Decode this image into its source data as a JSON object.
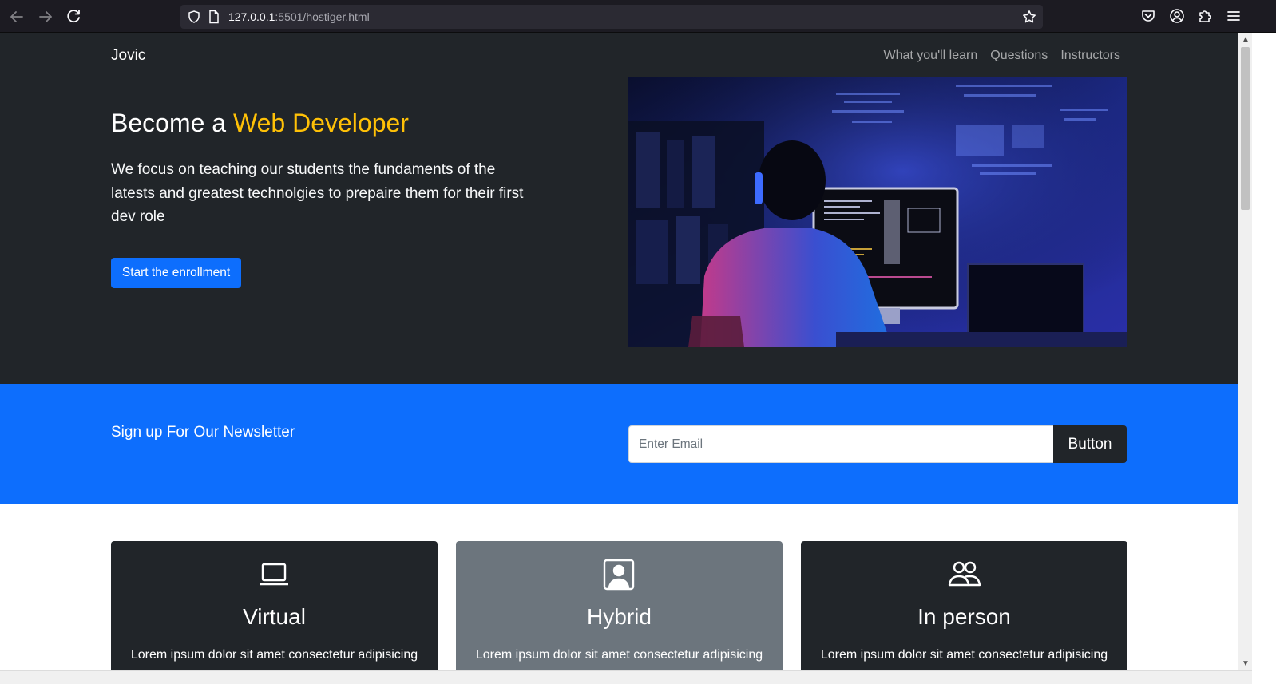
{
  "browser": {
    "url_host": "127.0.0.1",
    "url_rest": ":5501/hostiger.html",
    "icons": [
      "back-icon",
      "forward-icon",
      "reload-icon",
      "shield-icon",
      "page-icon",
      "bookmark-star-icon",
      "pocket-icon",
      "account-icon",
      "extensions-icon",
      "menu-icon"
    ]
  },
  "navbar": {
    "brand": "Jovic",
    "links": [
      "What you'll learn",
      "Questions",
      "Instructors"
    ]
  },
  "hero": {
    "title_prefix": "Become a ",
    "title_accent": "Web Developer",
    "description": "We focus on teaching our students the fundaments of the latests and greatest technolgies to prepaire them for their first dev role",
    "cta_label": "Start the enrollment",
    "accent_color": "#ffc107"
  },
  "newsletter": {
    "title": "Sign up For Our Newsletter",
    "email_placeholder": "Enter Email",
    "button_label": "Button",
    "bg_color": "#0d6efd"
  },
  "cards": [
    {
      "icon": "laptop-icon",
      "title": "Virtual",
      "text": "Lorem ipsum dolor sit amet consectetur adipisicing"
    },
    {
      "icon": "person-badge-icon",
      "title": "Hybrid",
      "text": "Lorem ipsum dolor sit amet consectetur adipisicing"
    },
    {
      "icon": "people-icon",
      "title": "In person",
      "text": "Lorem ipsum dolor sit amet consectetur adipisicing"
    }
  ]
}
